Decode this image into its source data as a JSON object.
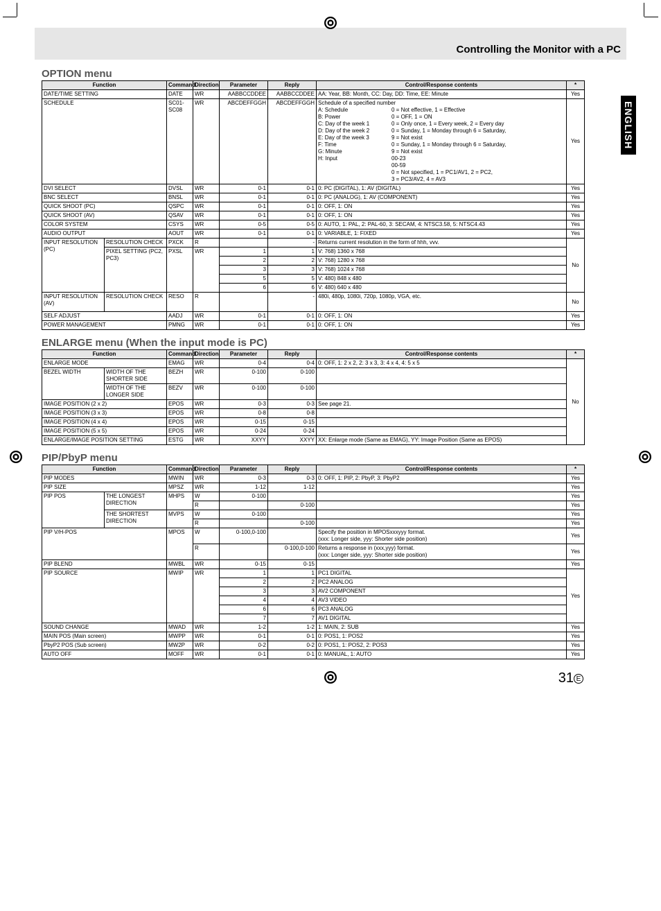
{
  "header_title": "Controlling the Monitor with a PC",
  "side_tab": "ENGLISH",
  "page_number": "31",
  "page_suffix": "E",
  "headers": {
    "function": "Function",
    "command": "Command",
    "direction": "Direction",
    "parameter": "Parameter",
    "reply": "Reply",
    "contents": "Control/Response contents",
    "star": "*"
  },
  "option": {
    "title": "OPTION menu",
    "rows": {
      "datetime": {
        "func": "DATE/TIME SETTING",
        "cmd": "DATE",
        "dir": "WR",
        "param": "AABBCCDDEE",
        "reply": "AABBCCDDEE",
        "cont": "AA: Year, BB: Month, CC: Day, DD: Time, EE: Minute",
        "star": "Yes"
      },
      "schedule": {
        "func": "SCHEDULE",
        "cmd": "SC01-SC08",
        "dir": "WR",
        "param": "ABCDEFFGGH",
        "reply": "ABCDEFFGGH",
        "intro": "Schedule of a specified number",
        "labels": [
          "A: Schedule",
          "B: Power",
          "C: Day of the week 1",
          "D: Day of the week 2",
          "",
          "E: Day of the week 3",
          "",
          "F: Time",
          "G: Minute",
          "H: Input",
          ""
        ],
        "values": [
          "0 = Not effective, 1 = Effective",
          "0 = OFF, 1 = ON",
          "0 = Only once, 1 = Every week, 2 = Every day",
          "0 = Sunday, 1 = Monday through 6 = Saturday,",
          "9 = Not exist",
          "0 = Sunday, 1 = Monday through 6 = Saturday,",
          "9 = Not exist",
          "00-23",
          "00-59",
          "0 = Not specified, 1 = PC1/AV1, 2 = PC2,",
          "3 = PC3/AV2, 4 = AV3"
        ],
        "star": "Yes"
      },
      "dvi": {
        "func": "DVI SELECT",
        "cmd": "DVSL",
        "dir": "WR",
        "param": "0-1",
        "reply": "0-1",
        "cont": "0: PC (DIGITAL), 1: AV (DIGITAL)",
        "star": "Yes"
      },
      "bnc": {
        "func": "BNC SELECT",
        "cmd": "BNSL",
        "dir": "WR",
        "param": "0-1",
        "reply": "0-1",
        "cont": "0: PC (ANALOG), 1: AV (COMPONENT)",
        "star": "Yes"
      },
      "qspc": {
        "func": "QUICK SHOOT (PC)",
        "cmd": "QSPC",
        "dir": "WR",
        "param": "0-1",
        "reply": "0-1",
        "cont": "0: OFF, 1: ON",
        "star": "Yes"
      },
      "qsav": {
        "func": "QUICK SHOOT (AV)",
        "cmd": "QSAV",
        "dir": "WR",
        "param": "0-1",
        "reply": "0-1",
        "cont": "0: OFF, 1: ON",
        "star": "Yes"
      },
      "csys": {
        "func": "COLOR SYSTEM",
        "cmd": "CSYS",
        "dir": "WR",
        "param": "0-5",
        "reply": "0-5",
        "cont": "0: AUTO, 1: PAL, 2: PAL-60, 3: SECAM, 4: NTSC3.58, 5: NTSC4.43",
        "star": "Yes"
      },
      "aout": {
        "func": "AUDIO OUTPUT",
        "cmd": "AOUT",
        "dir": "WR",
        "param": "0-1",
        "reply": "0-1",
        "cont": "0: VARIABLE, 1: FIXED",
        "star": "Yes"
      },
      "pxck_func1": "INPUT RESOLUTION (PC)",
      "pxck_func2": "RESOLUTION CHECK",
      "pxck": {
        "cmd": "PXCK",
        "dir": "R",
        "param": "",
        "reply": "-",
        "cont": "Returns current resolution in the form of hhh, vvv."
      },
      "pxsl_func2": "PIXEL SETTING (PC2, PC3)",
      "pxsl1": {
        "cmd": "PXSL",
        "dir": "WR",
        "param": "1",
        "reply": "1",
        "cont": "V: 768) 1360 x 768"
      },
      "pxsl2": {
        "param": "2",
        "reply": "2",
        "cont": "V: 768) 1280 x 768"
      },
      "pxsl3": {
        "param": "3",
        "reply": "3",
        "cont": "V: 768) 1024 x 768"
      },
      "pxsl5": {
        "param": "5",
        "reply": "5",
        "cont": "V: 480) 848 x 480"
      },
      "pxsl6": {
        "param": "6",
        "reply": "6",
        "cont": "V: 480) 640 x 480"
      },
      "pxck_star": "No",
      "reso_func1": "INPUT RESOLUTION (AV)",
      "reso_func2": "RESOLUTION CHECK",
      "reso": {
        "cmd": "RESO",
        "dir": "R",
        "param": "",
        "reply": "-",
        "cont": "480i, 480p, 1080i, 720p, 1080p, VGA, etc.",
        "star": "No"
      },
      "aadj": {
        "func": "SELF ADJUST",
        "cmd": "AADJ",
        "dir": "WR",
        "param": "0-1",
        "reply": "0-1",
        "cont": "0: OFF, 1: ON",
        "star": "Yes"
      },
      "pmng": {
        "func": "POWER MANAGEMENT",
        "cmd": "PMNG",
        "dir": "WR",
        "param": "0-1",
        "reply": "0-1",
        "cont": "0: OFF, 1: ON",
        "star": "Yes"
      }
    }
  },
  "enlarge": {
    "title": "ENLARGE menu (When the input mode is PC)",
    "rows": {
      "emag": {
        "func": "ENLARGE MODE",
        "cmd": "EMAG",
        "dir": "WR",
        "param": "0-4",
        "reply": "0-4",
        "cont": "0: OFF, 1: 2 x 2, 2: 3 x 3, 3: 4 x 4, 4: 5 x 5"
      },
      "bezh_func1": "BEZEL WIDTH",
      "bezh_func2": "WIDTH OF THE SHORTER SIDE",
      "bezh": {
        "cmd": "BEZH",
        "dir": "WR",
        "param": "0-100",
        "reply": "0-100",
        "cont": ""
      },
      "bezv_func2": "WIDTH OF THE LONGER SIDE",
      "bezv": {
        "cmd": "BEZV",
        "dir": "WR",
        "param": "0-100",
        "reply": "0-100",
        "cont": ""
      },
      "epos2": {
        "func": "IMAGE POSITION (2 x 2)",
        "cmd": "EPOS",
        "dir": "WR",
        "param": "0-3",
        "reply": "0-3",
        "cont": "See page 21."
      },
      "epos3": {
        "func": "IMAGE POSITION (3 x 3)",
        "cmd": "EPOS",
        "dir": "WR",
        "param": "0-8",
        "reply": "0-8",
        "cont": ""
      },
      "epos4": {
        "func": "IMAGE POSITION (4 x 4)",
        "cmd": "EPOS",
        "dir": "WR",
        "param": "0-15",
        "reply": "0-15",
        "cont": ""
      },
      "epos5": {
        "func": "IMAGE POSITION (5 x 5)",
        "cmd": "EPOS",
        "dir": "WR",
        "param": "0-24",
        "reply": "0-24",
        "cont": ""
      },
      "estg": {
        "func": "ENLARGE/IMAGE POSITION SETTING",
        "cmd": "ESTG",
        "dir": "WR",
        "param": "XXYY",
        "reply": "XXYY",
        "cont": "XX: Enlarge mode (Same as EMAG), YY: Image Position (Same as EPOS)"
      },
      "star": "No"
    }
  },
  "pip": {
    "title": "PIP/PbyP menu",
    "rows": {
      "mwin": {
        "func": "PIP MODES",
        "cmd": "MWIN",
        "dir": "WR",
        "param": "0-3",
        "reply": "0-3",
        "cont": "0: OFF, 1: PIP, 2: PbyP, 3: PbyP2",
        "star": "Yes"
      },
      "mpsz": {
        "func": "PIP SIZE",
        "cmd": "MPSZ",
        "dir": "WR",
        "param": "1-12",
        "reply": "1-12",
        "cont": "",
        "star": "Yes"
      },
      "pippos_func1": "PIP POS",
      "mhps_func2": "THE LONGEST DIRECTION",
      "mhpsW": {
        "cmd": "MHPS",
        "dir": "W",
        "param": "0-100",
        "reply": "",
        "cont": "",
        "star": "Yes"
      },
      "mhpsR": {
        "dir": "R",
        "param": "",
        "reply": "0-100",
        "cont": "",
        "star": "Yes"
      },
      "mvps_func2": "THE SHORTEST DIRECTION",
      "mvpsW": {
        "cmd": "MVPS",
        "dir": "W",
        "param": "0-100",
        "reply": "",
        "cont": "",
        "star": "Yes"
      },
      "mvpsR": {
        "dir": "R",
        "param": "",
        "reply": "0-100",
        "cont": "",
        "star": "Yes"
      },
      "mposW": {
        "func": "PIP V/H-POS",
        "cmd": "MPOS",
        "dir": "W",
        "param": "0-100,0-100",
        "reply": "",
        "cont": "Specify the position in MPOSxxxyyy format.\n(xxx: Longer side, yyy: Shorter side position)",
        "star": "Yes"
      },
      "mposR": {
        "dir": "R",
        "param": "",
        "reply": "0-100,0-100",
        "cont": "Returns a response in (xxx,yyy) format.\n(xxx: Longer side, yyy: Shorter side position)",
        "star": "Yes"
      },
      "mwbl": {
        "func": "PIP BLEND",
        "cmd": "MWBL",
        "dir": "WR",
        "param": "0-15",
        "reply": "0-15",
        "cont": "",
        "star": "Yes"
      },
      "mwip_func": "PIP SOURCE",
      "mwip1": {
        "cmd": "MWIP",
        "dir": "WR",
        "param": "1",
        "reply": "1",
        "cont": "PC1 DIGITAL"
      },
      "mwip2": {
        "param": "2",
        "reply": "2",
        "cont": "PC2 ANALOG"
      },
      "mwip3": {
        "param": "3",
        "reply": "3",
        "cont": "AV2 COMPONENT"
      },
      "mwip4": {
        "param": "4",
        "reply": "4",
        "cont": "AV3 VIDEO"
      },
      "mwip6": {
        "param": "6",
        "reply": "6",
        "cont": "PC3 ANALOG"
      },
      "mwip7": {
        "param": "7",
        "reply": "7",
        "cont": "AV1 DIGITAL"
      },
      "mwip_star": "Yes",
      "mwad": {
        "func": "SOUND CHANGE",
        "cmd": "MWAD",
        "dir": "WR",
        "param": "1-2",
        "reply": "1-2",
        "cont": "1: MAIN, 2: SUB",
        "star": "Yes"
      },
      "mwpp": {
        "func": "MAIN POS (Main screen)",
        "cmd": "MWPP",
        "dir": "WR",
        "param": "0-1",
        "reply": "0-1",
        "cont": "0: POS1, 1: POS2",
        "star": "Yes"
      },
      "mw2p": {
        "func": "PbyP2 POS (Sub screen)",
        "cmd": "MW2P",
        "dir": "WR",
        "param": "0-2",
        "reply": "0-2",
        "cont": "0: POS1, 1: POS2, 2: POS3",
        "star": "Yes"
      },
      "moff": {
        "func": "AUTO OFF",
        "cmd": "MOFF",
        "dir": "WR",
        "param": "0-1",
        "reply": "0-1",
        "cont": "0: MANUAL, 1: AUTO",
        "star": "Yes"
      }
    }
  }
}
